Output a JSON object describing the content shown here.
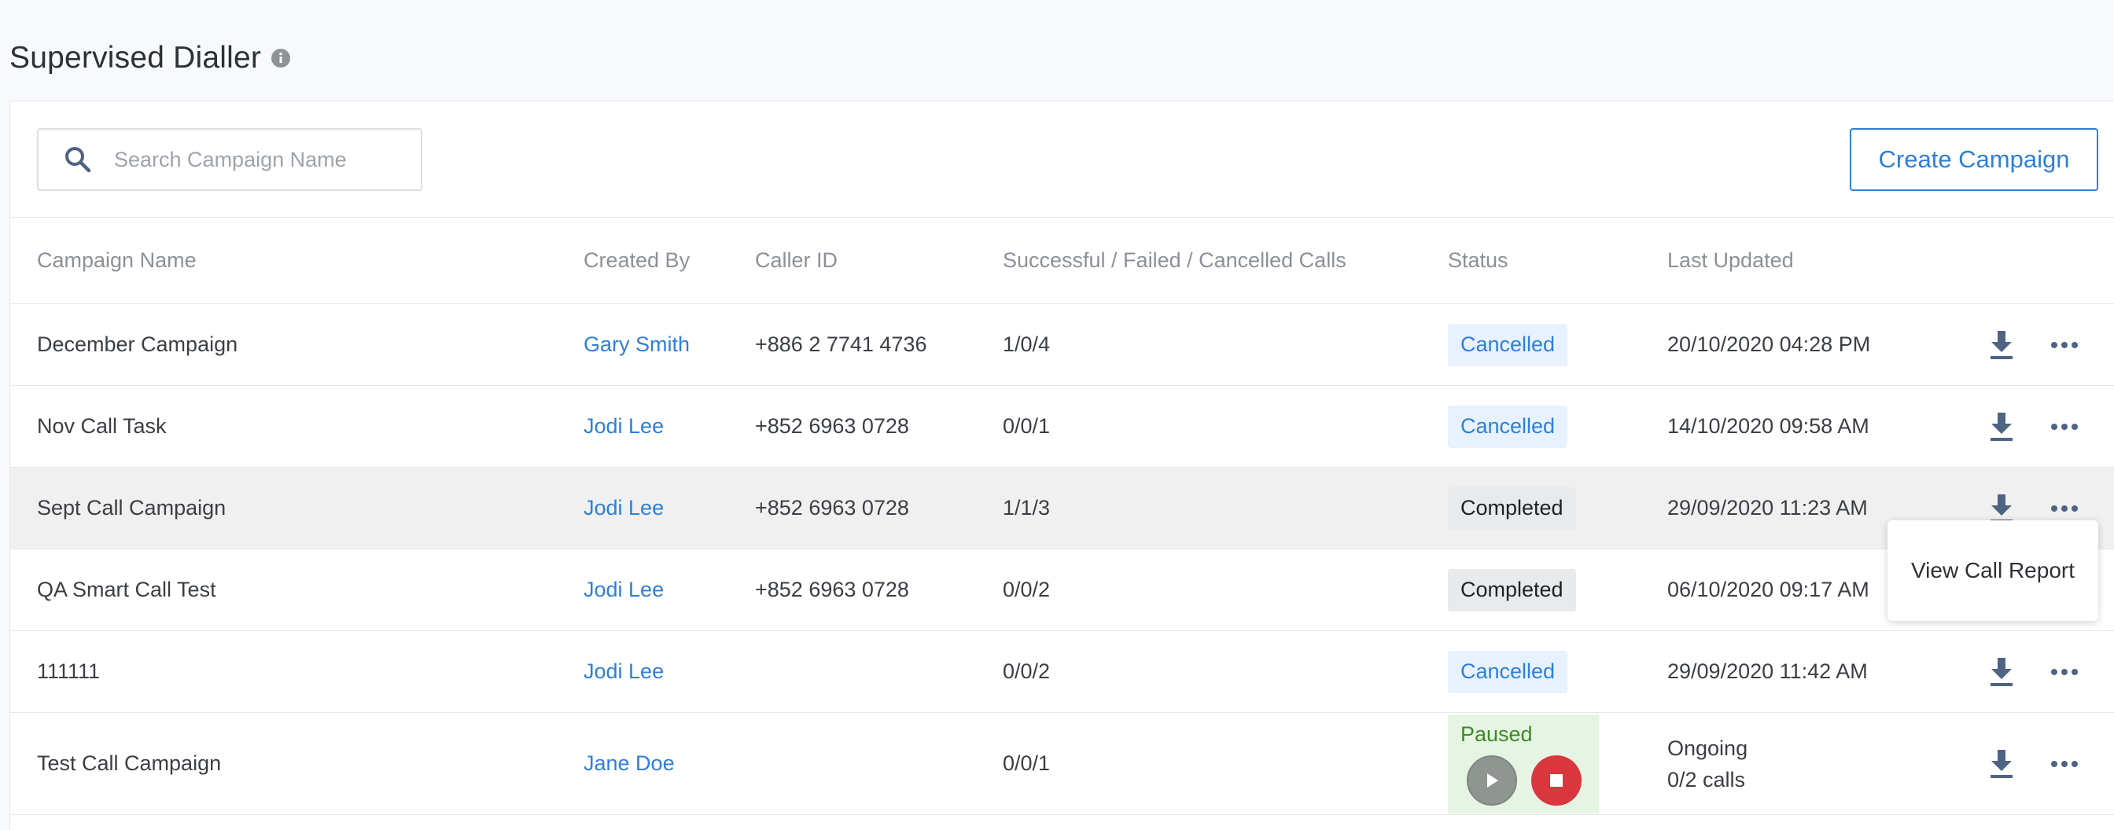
{
  "page": {
    "title": "Supervised Dialler"
  },
  "icons": {
    "info": "info-icon",
    "search": "search-icon",
    "download": "download-icon",
    "more": "more-icon",
    "play": "play-icon",
    "stop": "stop-icon"
  },
  "colors": {
    "accent": "#2f7fd8",
    "paused_bg": "#e6f4e3",
    "paused_text": "#3c8a25",
    "stop": "#d9363e"
  },
  "toolbar": {
    "search_placeholder": "Search Campaign Name",
    "search_value": "",
    "create_label": "Create Campaign"
  },
  "table": {
    "headers": {
      "name": "Campaign Name",
      "created_by": "Created By",
      "caller_id": "Caller ID",
      "calls": "Successful / Failed / Cancelled Calls",
      "status": "Status",
      "updated": "Last Updated"
    },
    "rows": [
      {
        "name": "December Campaign",
        "created_by": "Gary Smith",
        "caller_id": "+886 2 7741 4736",
        "calls": "1/0/4",
        "status": "Cancelled",
        "updated": "20/10/2020 04:28 PM"
      },
      {
        "name": "Nov Call Task",
        "created_by": "Jodi Lee",
        "caller_id": "+852 6963 0728",
        "calls": "0/0/1",
        "status": "Cancelled",
        "updated": "14/10/2020 09:58 AM"
      },
      {
        "name": "Sept Call Campaign",
        "created_by": "Jodi Lee",
        "caller_id": "+852 6963 0728",
        "calls": "1/1/3",
        "status": "Completed",
        "updated": "29/09/2020 11:23 AM"
      },
      {
        "name": "QA Smart Call Test",
        "created_by": "Jodi Lee",
        "caller_id": "+852 6963 0728",
        "calls": "0/0/2",
        "status": "Completed",
        "updated": "06/10/2020 09:17 AM"
      },
      {
        "name": "111111",
        "created_by": "Jodi Lee",
        "caller_id": "",
        "calls": "0/0/2",
        "status": "Cancelled",
        "updated": "29/09/2020 11:42 AM"
      },
      {
        "name": "Test Call Campaign",
        "created_by": "Jane Doe",
        "caller_id": "",
        "calls": "0/0/1",
        "status": "Paused",
        "updated_line1": "Ongoing",
        "updated_line2": "0/2 calls"
      }
    ]
  },
  "menu": {
    "items": [
      "View Call Report"
    ]
  }
}
